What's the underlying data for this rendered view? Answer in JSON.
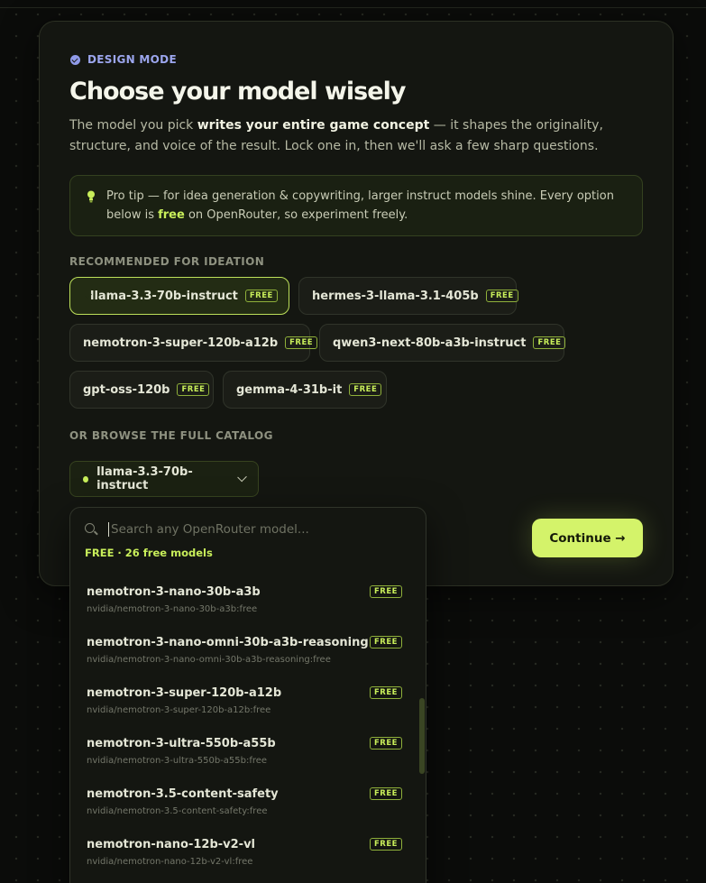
{
  "header": {
    "badge": "DESIGN MODE",
    "title": "Choose your model wisely",
    "description_pre": "The model you pick ",
    "description_bold": "writes your entire game concept",
    "description_post": " — it shapes the originality, structure, and voice of the result. Lock one in, then we'll ask a few sharp questions."
  },
  "tip": {
    "text_pre": "Pro tip — for idea generation & copywriting, larger instruct models shine. Every option below is ",
    "text_free": "free",
    "text_post": " on OpenRouter, so experiment freely."
  },
  "recommended": {
    "label": "RECOMMENDED FOR IDEATION",
    "free_tag": "FREE",
    "chips": [
      {
        "label": "llama-3.3-70b-instruct",
        "selected": true
      },
      {
        "label": "hermes-3-llama-3.1-405b",
        "selected": false
      },
      {
        "label": "nemotron-3-super-120b-a12b",
        "selected": false
      },
      {
        "label": "qwen3-next-80b-a3b-instruct",
        "selected": false
      },
      {
        "label": "gpt-oss-120b",
        "selected": false
      },
      {
        "label": "gemma-4-31b-it",
        "selected": false
      }
    ]
  },
  "catalog": {
    "label": "OR BROWSE THE FULL CATALOG",
    "selected": "llama-3.3-70b-instruct",
    "search_placeholder": "Search any OpenRouter model...",
    "free_count": "FREE · 26 free models",
    "items": [
      {
        "name": "nemotron-3-nano-30b-a3b",
        "id": "nvidia/nemotron-3-nano-30b-a3b:free",
        "tag": "FREE"
      },
      {
        "name": "nemotron-3-nano-omni-30b-a3b-reasoning",
        "id": "nvidia/nemotron-3-nano-omni-30b-a3b-reasoning:free",
        "tag": "FREE"
      },
      {
        "name": "nemotron-3-super-120b-a12b",
        "id": "nvidia/nemotron-3-super-120b-a12b:free",
        "tag": "FREE"
      },
      {
        "name": "nemotron-3-ultra-550b-a55b",
        "id": "nvidia/nemotron-3-ultra-550b-a55b:free",
        "tag": "FREE"
      },
      {
        "name": "nemotron-3.5-content-safety",
        "id": "nvidia/nemotron-3.5-content-safety:free",
        "tag": "FREE"
      },
      {
        "name": "nemotron-nano-12b-v2-vl",
        "id": "nvidia/nemotron-nano-12b-v2-vl:free",
        "tag": "FREE"
      }
    ]
  },
  "actions": {
    "continue": "Continue →"
  },
  "colors": {
    "accent": "#c8ee5a",
    "badge": "#9ca6ee",
    "background": "#0b0c0a"
  }
}
